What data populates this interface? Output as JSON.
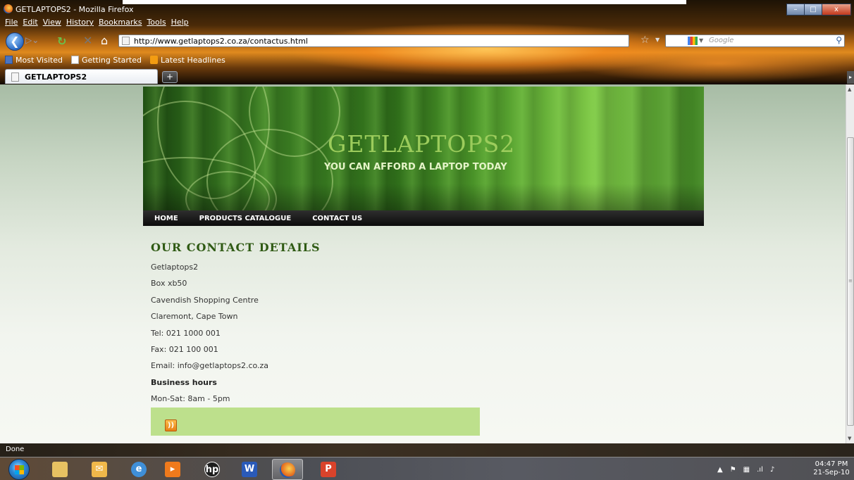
{
  "window": {
    "title": "GETLAPTOPS2 - Mozilla Firefox",
    "controls": {
      "minimize": "–",
      "maximize": "□",
      "close": "x"
    }
  },
  "menubar": [
    "File",
    "Edit",
    "View",
    "History",
    "Bookmarks",
    "Tools",
    "Help"
  ],
  "navigation": {
    "url": "http://www.getlaptops2.co.za/contactus.html",
    "search_placeholder": "Google"
  },
  "bookmarks": [
    "Most Visited",
    "Getting Started",
    "Latest Headlines"
  ],
  "tabs": {
    "active_label": "GETLAPTOPS2",
    "new_tab_label": "+"
  },
  "site": {
    "title": "GETLAPTOPS2",
    "tagline": "YOU CAN AFFORD A LAPTOP TODAY",
    "nav": [
      "HOME",
      "PRODUCTS CATALOGUE",
      "CONTACT US"
    ]
  },
  "contact": {
    "heading": "OUR CONTACT DETAILS",
    "company": "Getlaptops2",
    "box": "Box xb50",
    "centre": "Cavendish Shopping Centre",
    "city": "Claremont, Cape Town",
    "tel": "Tel: 021 1000 001",
    "fax": "Fax: 021 100 001",
    "email": "Email: info@getlaptops2.co.za",
    "hours_heading": "Business hours",
    "hours": "Mon-Sat: 8am - 5pm"
  },
  "status": {
    "text": "Done"
  },
  "clock": {
    "time": "04:47 PM",
    "date": "21-Sep-10"
  },
  "colors": {
    "banner_green": "#3a7b22",
    "heading_green": "#2f5a14",
    "footer_box": "#bde08c"
  }
}
